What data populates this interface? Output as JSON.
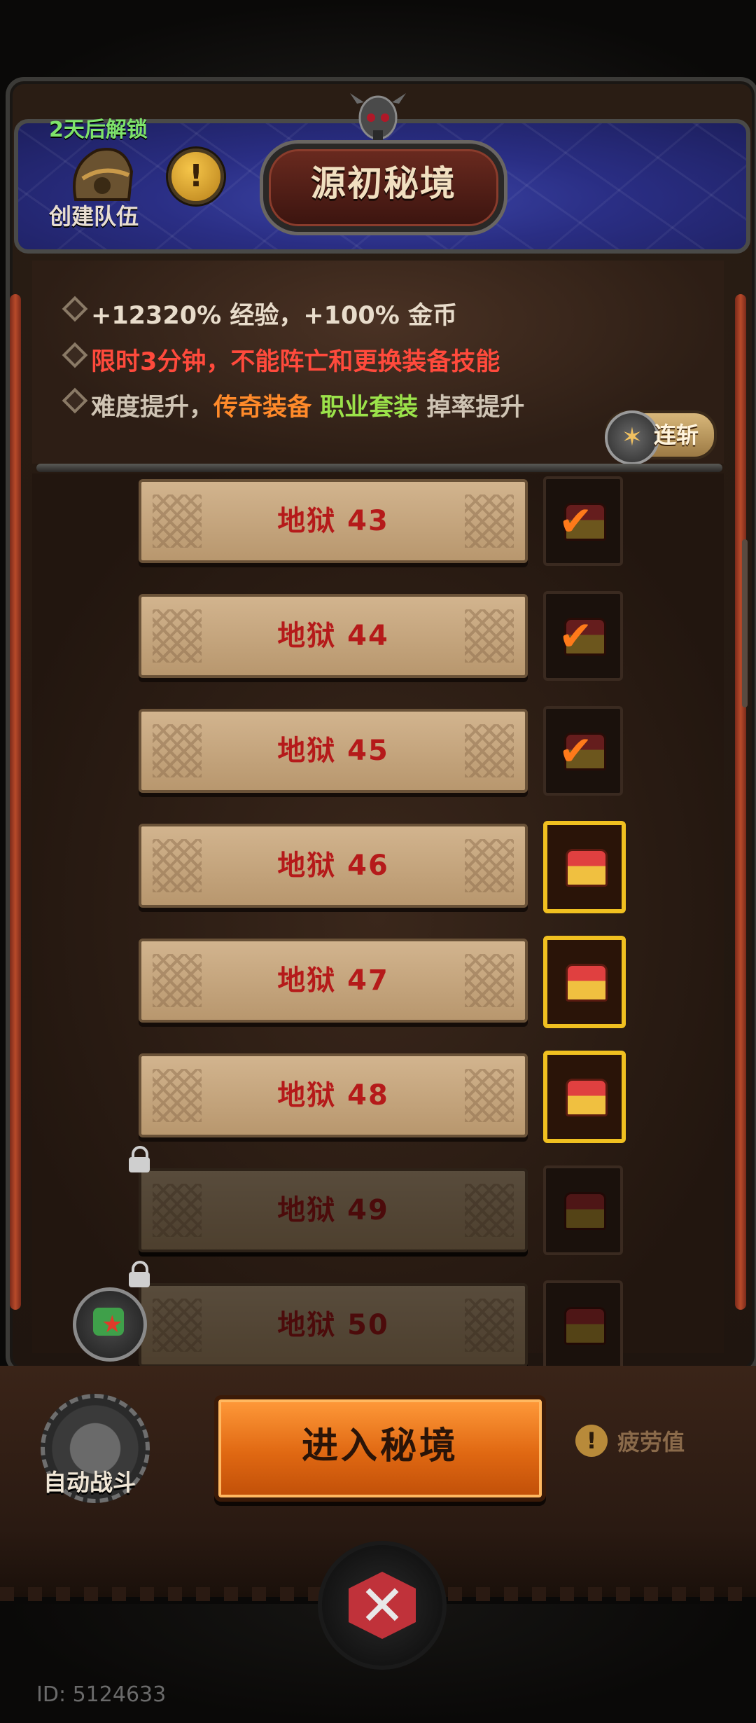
{
  "header": {
    "title": "源初秘境",
    "unlock_text": "2天后解锁",
    "team_label": "创建队伍",
    "info_icon": "!"
  },
  "info": {
    "line1": "+12320% 经验，+100% 金币",
    "line2": "限时3分钟，不能阵亡和更换装备技能",
    "line3_prefix": "难度提升，",
    "line3_legend": "传奇装备",
    "line3_set": "职业套装",
    "line3_suffix": "掉率提升",
    "combo_label": "连斩"
  },
  "levels": [
    {
      "label": "地狱 43",
      "reward": "claimed",
      "locked": false
    },
    {
      "label": "地狱 44",
      "reward": "claimed",
      "locked": false
    },
    {
      "label": "地狱 45",
      "reward": "claimed",
      "locked": false
    },
    {
      "label": "地狱 46",
      "reward": "available",
      "locked": false
    },
    {
      "label": "地狱 47",
      "reward": "available",
      "locked": false
    },
    {
      "label": "地狱 48",
      "reward": "available",
      "locked": false
    },
    {
      "label": "地狱 49",
      "reward": "locked",
      "locked": true
    },
    {
      "label": "地狱 50",
      "reward": "locked",
      "locked": true
    }
  ],
  "bottom": {
    "auto_battle_label": "自动战斗",
    "enter_button_label": "进入秘境",
    "fatigue_label": "疲劳值",
    "fatigue_icon": "!"
  },
  "player": {
    "id_text": "ID: 5124633"
  },
  "colors": {
    "legend": "#ff8a2a",
    "set": "#9be24a",
    "warning": "#ff4a3c",
    "unlock": "#7ee36a"
  }
}
